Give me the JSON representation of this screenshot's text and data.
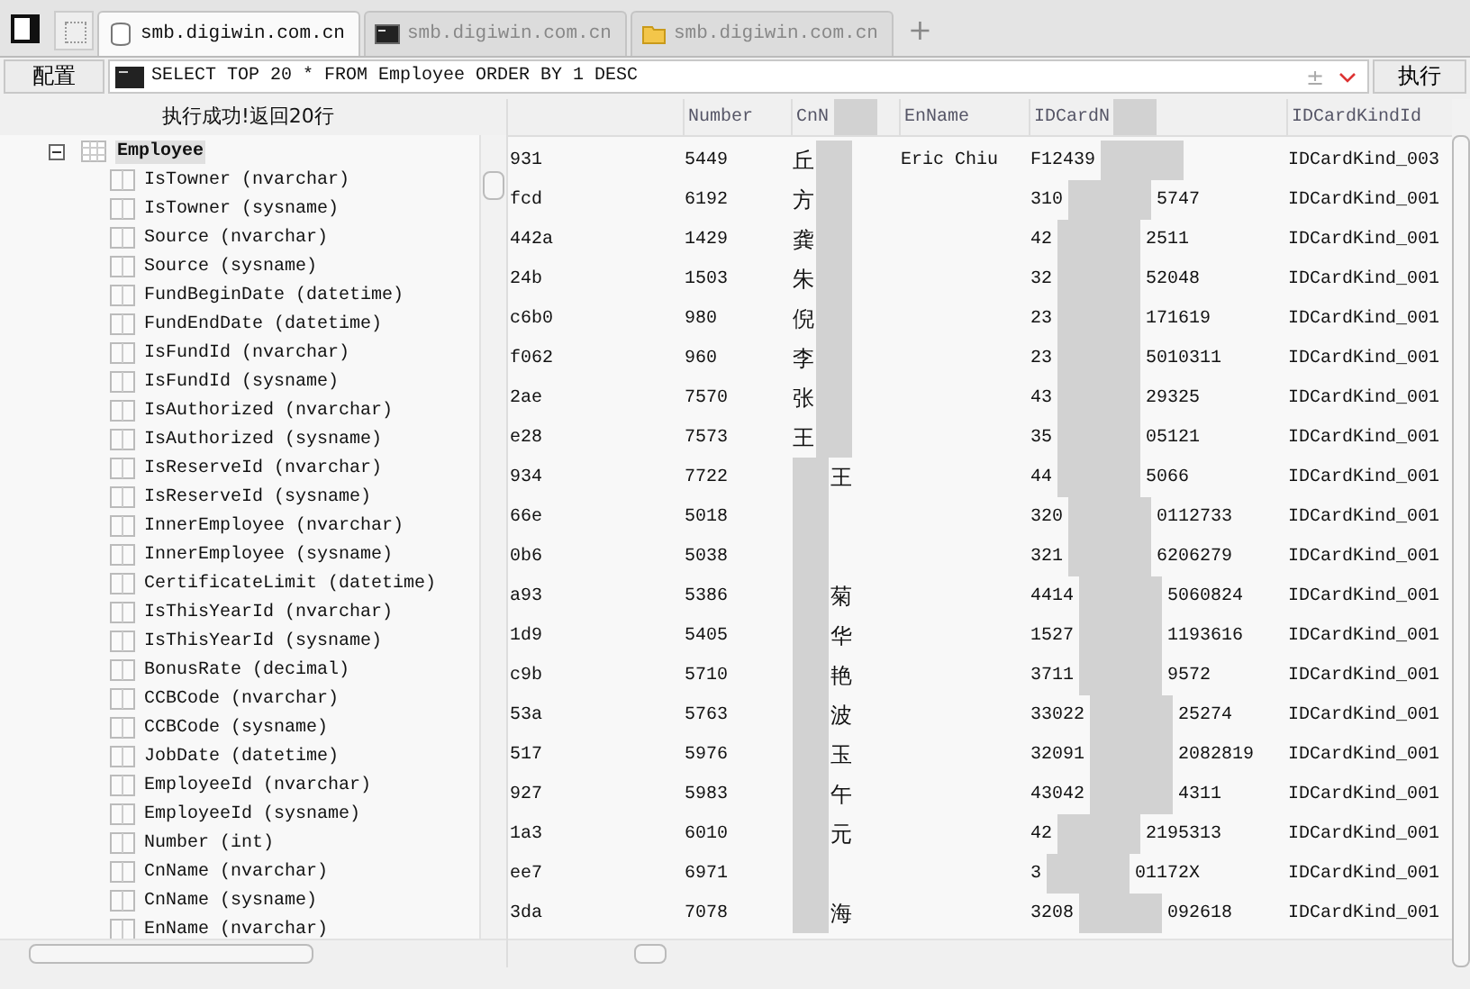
{
  "tabs": [
    {
      "label": "smb.digiwin.com.cn",
      "kind": "database",
      "selected": true
    },
    {
      "label": "smb.digiwin.com.cn",
      "kind": "terminal",
      "selected": false
    },
    {
      "label": "smb.digiwin.com.cn",
      "kind": "folder",
      "selected": false
    }
  ],
  "new_tab": "+",
  "toolbar": {
    "config_button": "配置",
    "query": "SELECT TOP 20 * FROM Employee ORDER BY 1 DESC",
    "query_toggle": "±",
    "execute_button": "执行"
  },
  "status": "执行成功!返回20行",
  "tree": {
    "label": "Employee",
    "expanded": true,
    "selected": true,
    "children": [
      {
        "label": "IsTowner (nvarchar)"
      },
      {
        "label": "IsTowner (sysname)"
      },
      {
        "label": "Source (nvarchar)"
      },
      {
        "label": "Source (sysname)"
      },
      {
        "label": "FundBeginDate (datetime)"
      },
      {
        "label": "FundEndDate (datetime)"
      },
      {
        "label": "IsFundId (nvarchar)"
      },
      {
        "label": "IsFundId (sysname)"
      },
      {
        "label": "IsAuthorized (nvarchar)"
      },
      {
        "label": "IsAuthorized (sysname)"
      },
      {
        "label": "IsReserveId (nvarchar)"
      },
      {
        "label": "IsReserveId (sysname)"
      },
      {
        "label": "InnerEmployee (nvarchar)"
      },
      {
        "label": "InnerEmployee (sysname)"
      },
      {
        "label": "CertificateLimit (datetime)"
      },
      {
        "label": "IsThisYearId (nvarchar)"
      },
      {
        "label": "IsThisYearId (sysname)"
      },
      {
        "label": "BonusRate (decimal)"
      },
      {
        "label": "CCBCode (nvarchar)"
      },
      {
        "label": "CCBCode (sysname)"
      },
      {
        "label": "JobDate (datetime)"
      },
      {
        "label": "EmployeeId (nvarchar)"
      },
      {
        "label": "EmployeeId (sysname)"
      },
      {
        "label": "Number (int)"
      },
      {
        "label": "CnName (nvarchar)"
      },
      {
        "label": "CnName (sysname)"
      },
      {
        "label": "EnName (nvarchar)"
      }
    ]
  },
  "table": {
    "columns": [
      {
        "label": "Number",
        "redacted": false
      },
      {
        "label": "CnN",
        "redacted": true
      },
      {
        "label": "EnName",
        "redacted": false
      },
      {
        "label": "IDCardN",
        "redacted": true
      },
      {
        "label": "IDCardKindId",
        "redacted": false
      }
    ],
    "rows": [
      {
        "key": "931",
        "number": "5449",
        "cn_start": "丘",
        "cn_end": "",
        "en_name": "Eric Chiu",
        "id_start": "F12439",
        "id_end": "",
        "kind": "IDCardKind_003"
      },
      {
        "key": "fcd",
        "number": "6192",
        "cn_start": "方",
        "cn_end": "",
        "en_name": "",
        "id_start": "310",
        "id_end": "5747",
        "kind": "IDCardKind_001"
      },
      {
        "key": "442a",
        "number": "1429",
        "cn_start": "龚",
        "cn_end": "",
        "en_name": "",
        "id_start": "42",
        "id_end": "2511",
        "kind": "IDCardKind_001"
      },
      {
        "key": "24b",
        "number": "1503",
        "cn_start": "朱",
        "cn_end": "",
        "en_name": "",
        "id_start": "32",
        "id_end": "52048",
        "kind": "IDCardKind_001"
      },
      {
        "key": "c6b0",
        "number": "980",
        "cn_start": "倪",
        "cn_end": "",
        "en_name": "",
        "id_start": "23",
        "id_end": "171619",
        "kind": "IDCardKind_001"
      },
      {
        "key": "f062",
        "number": "960",
        "cn_start": "李",
        "cn_end": "",
        "en_name": "",
        "id_start": "23",
        "id_end": "5010311",
        "kind": "IDCardKind_001"
      },
      {
        "key": "2ae",
        "number": "7570",
        "cn_start": "张",
        "cn_end": "",
        "en_name": "",
        "id_start": "43",
        "id_end": "29325",
        "kind": "IDCardKind_001"
      },
      {
        "key": "e28",
        "number": "7573",
        "cn_start": "王",
        "cn_end": "",
        "en_name": "",
        "id_start": "35",
        "id_end": "05121",
        "kind": "IDCardKind_001"
      },
      {
        "key": "934",
        "number": "7722",
        "cn_start": "",
        "cn_end": "王",
        "en_name": "",
        "id_start": "44",
        "id_end": "5066",
        "kind": "IDCardKind_001"
      },
      {
        "key": "66e",
        "number": "5018",
        "cn_start": "",
        "cn_end": "",
        "en_name": "",
        "id_start": "320",
        "id_end": "0112733",
        "kind": "IDCardKind_001"
      },
      {
        "key": "0b6",
        "number": "5038",
        "cn_start": "",
        "cn_end": "",
        "en_name": "",
        "id_start": "321",
        "id_end": "6206279",
        "kind": "IDCardKind_001"
      },
      {
        "key": "a93",
        "number": "5386",
        "cn_start": "",
        "cn_end": "菊",
        "en_name": "",
        "id_start": "4414",
        "id_end": "5060824",
        "kind": "IDCardKind_001"
      },
      {
        "key": "1d9",
        "number": "5405",
        "cn_start": "",
        "cn_end": "华",
        "en_name": "",
        "id_start": "1527",
        "id_end": "1193616",
        "kind": "IDCardKind_001"
      },
      {
        "key": "c9b",
        "number": "5710",
        "cn_start": "",
        "cn_end": "艳",
        "en_name": "",
        "id_start": "3711",
        "id_end": "9572",
        "kind": "IDCardKind_001"
      },
      {
        "key": "53a",
        "number": "5763",
        "cn_start": "",
        "cn_end": "波",
        "en_name": "",
        "id_start": "33022",
        "id_end": "25274",
        "kind": "IDCardKind_001"
      },
      {
        "key": "517",
        "number": "5976",
        "cn_start": "",
        "cn_end": "玉",
        "en_name": "",
        "id_start": "32091",
        "id_end": "2082819",
        "kind": "IDCardKind_001"
      },
      {
        "key": "927",
        "number": "5983",
        "cn_start": "",
        "cn_end": "午",
        "en_name": "",
        "id_start": "43042",
        "id_end": "4311",
        "kind": "IDCardKind_001"
      },
      {
        "key": "1a3",
        "number": "6010",
        "cn_start": "",
        "cn_end": "元",
        "en_name": "",
        "id_start": "42",
        "id_end": "2195313",
        "kind": "IDCardKind_001"
      },
      {
        "key": "ee7",
        "number": "6971",
        "cn_start": "",
        "cn_end": "",
        "en_name": "",
        "id_start": "3",
        "id_end": "01172X",
        "kind": "IDCardKind_001"
      },
      {
        "key": "3da",
        "number": "7078",
        "cn_start": "",
        "cn_end": "海",
        "en_name": "",
        "id_start": "3208",
        "id_end": "092618",
        "kind": "IDCardKind_001"
      }
    ]
  }
}
